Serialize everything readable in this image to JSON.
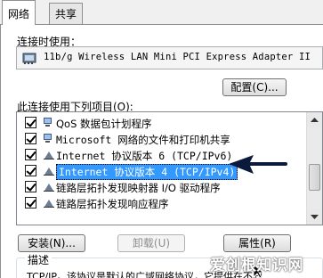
{
  "tabs": [
    {
      "label": "网络",
      "active": true
    },
    {
      "label": "共享",
      "active": false
    }
  ],
  "connect_using_label": "连接时使用：",
  "adapter": {
    "name": "11b/g Wireless LAN Mini PCI Express Adapter II"
  },
  "configure_button": "配置(C)...",
  "items_label": "此连接使用下列项目(O):",
  "items": [
    {
      "label": "QoS 数据包计划程序",
      "checked": true,
      "icon": "qos-icon"
    },
    {
      "label": "Microsoft 网络的文件和打印机共享",
      "checked": true,
      "icon": "network-share-icon"
    },
    {
      "label": "Internet 协议版本 6 (TCP/IPv6)",
      "checked": true,
      "icon": "protocol-icon"
    },
    {
      "label": "Internet 协议版本 4 (TCP/IPv4)",
      "checked": true,
      "icon": "protocol-icon",
      "selected": true
    },
    {
      "label": "链路层拓扑发现映射器 I/O 驱动程序",
      "checked": true,
      "icon": "protocol-icon"
    },
    {
      "label": "链路层拓扑发现响应程序",
      "checked": true,
      "icon": "protocol-icon"
    }
  ],
  "buttons": {
    "install": "安装(N)...",
    "uninstall": "卸载(U)",
    "properties": "属性(R)"
  },
  "description": {
    "title": "描述",
    "text": "TCP/IP。该协议是默认的广域网络协议，它提供在不同"
  },
  "watermark": "爱创根知识网",
  "colors": {
    "selection": "#3399ff",
    "arrow": "#0b1a3a"
  }
}
